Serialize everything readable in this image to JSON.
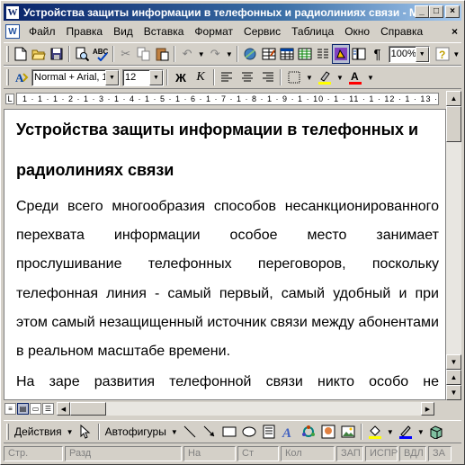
{
  "window": {
    "title": "Устройства защиты информации в телефонных и радиолиниях связи - Microsoft Word",
    "app_icon": "W"
  },
  "menu": {
    "doc_icon": "W",
    "items": [
      "Файл",
      "Правка",
      "Вид",
      "Вставка",
      "Формат",
      "Сервис",
      "Таблица",
      "Окно",
      "Справка"
    ],
    "close_glyph": "×"
  },
  "toolbar_standard": {
    "zoom": "100%"
  },
  "toolbar_format": {
    "style": "Normal + Arial, 1",
    "size": "12",
    "bold_label": "Ж",
    "italic_label": "К"
  },
  "ruler": {
    "text": "1 · 1 · 1 · 2 · 1 · 3 · 1 · 4 · 1 · 5 · 1 · 6 · 1 · 7 · 1 · 8 · 1 · 9 · 1 · 10 · 1 · 11 · 1 · 12 · 1 · 13 ·"
  },
  "document": {
    "title": "Устройства защиты информации в телефонных и радиолиниях связи",
    "paragraph1": "Среди всего многообразия способов несанкционированного перехвата информации особое место занимает прослушивание телефонных переговоров, поскольку телефонная линия - самый первый, самый удобный и при этом самый незащищенный источник связи между абонентами в реальном масштабе времени.",
    "paragraph2": "На заре развития телефонной связи никто особо не задумывался о защите линий от прослушивания и"
  },
  "drawing_toolbar": {
    "actions_label": "Действия",
    "autoshapes_label": "Автофигуры"
  },
  "statusbar": {
    "page": "Стр.",
    "section": "Разд",
    "position": "На",
    "line": "Ст",
    "column": "Кол",
    "rec": "ЗАП",
    "track": "ИСПР",
    "extend": "ВДЛ",
    "overwrite": "ЗА"
  },
  "colors": {
    "title_gradient_start": "#0a246a",
    "title_gradient_end": "#a6caf0",
    "chrome": "#d4d0c8",
    "highlight_yellow": "#ffff00",
    "font_color_red": "#ff0000",
    "line_color_blue": "#0000ff"
  }
}
